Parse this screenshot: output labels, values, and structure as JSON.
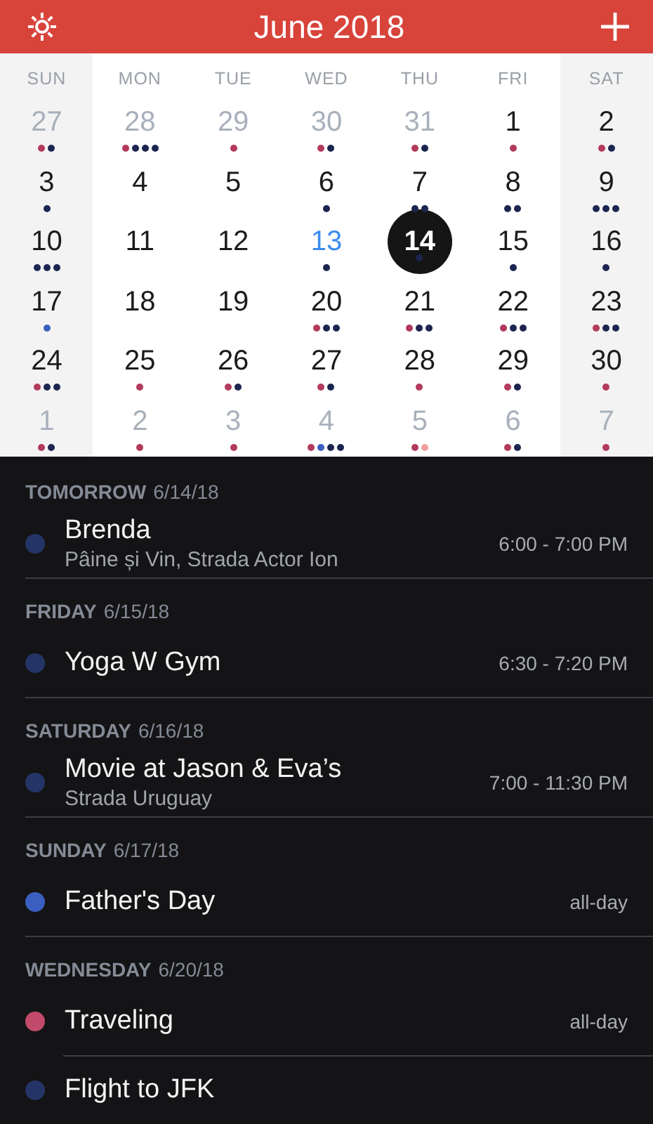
{
  "header": {
    "title": "June 2018"
  },
  "weekdays": [
    {
      "label": "SUN",
      "weekend": true
    },
    {
      "label": "MON",
      "weekend": false
    },
    {
      "label": "TUE",
      "weekend": false
    },
    {
      "label": "WED",
      "weekend": false
    },
    {
      "label": "THU",
      "weekend": false
    },
    {
      "label": "FRI",
      "weekend": false
    },
    {
      "label": "SAT",
      "weekend": true
    }
  ],
  "weeks": [
    {
      "days": [
        {
          "day": "27",
          "outside": true,
          "today": false,
          "selected": false,
          "dots": [
            {
              "color": "#b23a5a"
            },
            {
              "color": "#1c2550"
            }
          ]
        },
        {
          "day": "28",
          "outside": true,
          "today": false,
          "selected": false,
          "dots": [
            {
              "color": "#b23a5a"
            },
            {
              "color": "#1c2550"
            },
            {
              "color": "#1c2550"
            },
            {
              "color": "#1c2550"
            }
          ]
        },
        {
          "day": "29",
          "outside": true,
          "today": false,
          "selected": false,
          "dots": [
            {
              "color": "#b23a5a"
            }
          ]
        },
        {
          "day": "30",
          "outside": true,
          "today": false,
          "selected": false,
          "dots": [
            {
              "color": "#b23a5a"
            },
            {
              "color": "#1c2550"
            }
          ]
        },
        {
          "day": "31",
          "outside": true,
          "today": false,
          "selected": false,
          "dots": [
            {
              "color": "#b23a5a"
            },
            {
              "color": "#1c2550"
            }
          ]
        },
        {
          "day": "1",
          "outside": false,
          "today": false,
          "selected": false,
          "dots": [
            {
              "color": "#b23a5a"
            }
          ]
        },
        {
          "day": "2",
          "outside": false,
          "today": false,
          "selected": false,
          "dots": [
            {
              "color": "#b23a5a"
            },
            {
              "color": "#1c2550"
            }
          ]
        }
      ]
    },
    {
      "days": [
        {
          "day": "3",
          "outside": false,
          "today": false,
          "selected": false,
          "dots": [
            {
              "color": "#1c2550"
            }
          ]
        },
        {
          "day": "4",
          "outside": false,
          "today": false,
          "selected": false
        },
        {
          "day": "5",
          "outside": false,
          "today": false,
          "selected": false
        },
        {
          "day": "6",
          "outside": false,
          "today": false,
          "selected": false,
          "dots": [
            {
              "color": "#1c2550"
            }
          ]
        },
        {
          "day": "7",
          "outside": false,
          "today": false,
          "selected": false,
          "dots": [
            {
              "color": "#1c2550"
            },
            {
              "color": "#1c2550"
            }
          ]
        },
        {
          "day": "8",
          "outside": false,
          "today": false,
          "selected": false,
          "dots": [
            {
              "color": "#1c2550"
            },
            {
              "color": "#1c2550"
            }
          ]
        },
        {
          "day": "9",
          "outside": false,
          "today": false,
          "selected": false,
          "dots": [
            {
              "color": "#1c2550"
            },
            {
              "color": "#1c2550"
            },
            {
              "color": "#1c2550"
            }
          ]
        }
      ]
    },
    {
      "days": [
        {
          "day": "10",
          "outside": false,
          "today": false,
          "selected": false,
          "dots": [
            {
              "color": "#1c2550"
            },
            {
              "color": "#1c2550"
            },
            {
              "color": "#1c2550"
            }
          ]
        },
        {
          "day": "11",
          "outside": false,
          "today": false,
          "selected": false
        },
        {
          "day": "12",
          "outside": false,
          "today": false,
          "selected": false
        },
        {
          "day": "13",
          "outside": false,
          "today": true,
          "selected": false,
          "dots": [
            {
              "color": "#1c2550"
            }
          ]
        },
        {
          "day": "14",
          "outside": false,
          "today": false,
          "selected": true,
          "dots": [
            {
              "color": "#1c2550"
            }
          ]
        },
        {
          "day": "15",
          "outside": false,
          "today": false,
          "selected": false,
          "dots": [
            {
              "color": "#1c2550"
            }
          ]
        },
        {
          "day": "16",
          "outside": false,
          "today": false,
          "selected": false,
          "dots": [
            {
              "color": "#1c2550"
            }
          ]
        }
      ]
    },
    {
      "days": [
        {
          "day": "17",
          "outside": false,
          "today": false,
          "selected": false,
          "dots": [
            {
              "color": "#3a5fc0"
            }
          ]
        },
        {
          "day": "18",
          "outside": false,
          "today": false,
          "selected": false
        },
        {
          "day": "19",
          "outside": false,
          "today": false,
          "selected": false
        },
        {
          "day": "20",
          "outside": false,
          "today": false,
          "selected": false,
          "dots": [
            {
              "color": "#b23a5a"
            },
            {
              "color": "#1c2550"
            },
            {
              "color": "#1c2550"
            }
          ]
        },
        {
          "day": "21",
          "outside": false,
          "today": false,
          "selected": false,
          "dots": [
            {
              "color": "#b23a5a"
            },
            {
              "color": "#1c2550"
            },
            {
              "color": "#1c2550"
            }
          ]
        },
        {
          "day": "22",
          "outside": false,
          "today": false,
          "selected": false,
          "dots": [
            {
              "color": "#b23a5a"
            },
            {
              "color": "#1c2550"
            },
            {
              "color": "#1c2550"
            }
          ]
        },
        {
          "day": "23",
          "outside": false,
          "today": false,
          "selected": false,
          "dots": [
            {
              "color": "#b23a5a"
            },
            {
              "color": "#1c2550"
            },
            {
              "color": "#1c2550"
            }
          ]
        }
      ]
    },
    {
      "days": [
        {
          "day": "24",
          "outside": false,
          "today": false,
          "selected": false,
          "dots": [
            {
              "color": "#b23a5a"
            },
            {
              "color": "#1c2550"
            },
            {
              "color": "#1c2550"
            }
          ]
        },
        {
          "day": "25",
          "outside": false,
          "today": false,
          "selected": false,
          "dots": [
            {
              "color": "#b23a5a"
            }
          ]
        },
        {
          "day": "26",
          "outside": false,
          "today": false,
          "selected": false,
          "dots": [
            {
              "color": "#b23a5a"
            },
            {
              "color": "#1c2550"
            }
          ]
        },
        {
          "day": "27",
          "outside": false,
          "today": false,
          "selected": false,
          "dots": [
            {
              "color": "#b23a5a"
            },
            {
              "color": "#1c2550"
            }
          ]
        },
        {
          "day": "28",
          "outside": false,
          "today": false,
          "selected": false,
          "dots": [
            {
              "color": "#b23a5a"
            }
          ]
        },
        {
          "day": "29",
          "outside": false,
          "today": false,
          "selected": false,
          "dots": [
            {
              "color": "#b23a5a"
            },
            {
              "color": "#1c2550"
            }
          ]
        },
        {
          "day": "30",
          "outside": false,
          "today": false,
          "selected": false,
          "dots": [
            {
              "color": "#b23a5a"
            }
          ]
        }
      ]
    },
    {
      "days": [
        {
          "day": "1",
          "outside": true,
          "today": false,
          "selected": false,
          "dots": [
            {
              "color": "#b23a5a"
            },
            {
              "color": "#1c2550"
            }
          ]
        },
        {
          "day": "2",
          "outside": true,
          "today": false,
          "selected": false,
          "dots": [
            {
              "color": "#b23a5a"
            }
          ]
        },
        {
          "day": "3",
          "outside": true,
          "today": false,
          "selected": false,
          "dots": [
            {
              "color": "#b23a5a"
            }
          ]
        },
        {
          "day": "4",
          "outside": true,
          "today": false,
          "selected": false,
          "dots": [
            {
              "color": "#b23a5a"
            },
            {
              "color": "#3a5fc0"
            },
            {
              "color": "#1c2550"
            },
            {
              "color": "#1c2550"
            }
          ]
        },
        {
          "day": "5",
          "outside": true,
          "today": false,
          "selected": false,
          "dots": [
            {
              "color": "#b23a5a"
            },
            {
              "color": "#f0a0a0"
            }
          ]
        },
        {
          "day": "6",
          "outside": true,
          "today": false,
          "selected": false,
          "dots": [
            {
              "color": "#b23a5a"
            },
            {
              "color": "#1c2550"
            }
          ]
        },
        {
          "day": "7",
          "outside": true,
          "today": false,
          "selected": false,
          "dots": [
            {
              "color": "#b23a5a"
            }
          ]
        }
      ]
    }
  ],
  "agenda": [
    {
      "day": "TOMORROW",
      "date": "6/14/18",
      "events": [
        {
          "title": "Brenda",
          "location": "Pâine și Vin, Strada Actor Ion",
          "time": "6:00 - 7:00 PM",
          "color": "#243466"
        }
      ]
    },
    {
      "day": "FRIDAY",
      "date": "6/15/18",
      "events": [
        {
          "title": "Yoga W Gym",
          "time": "6:30 - 7:20 PM",
          "color": "#243466"
        }
      ]
    },
    {
      "day": "SATURDAY",
      "date": "6/16/18",
      "events": [
        {
          "title": "Movie at Jason & Eva’s",
          "location": "Strada Uruguay",
          "time": "7:00 - 11:30 PM",
          "color": "#243466"
        }
      ]
    },
    {
      "day": "SUNDAY",
      "date": "6/17/18",
      "events": [
        {
          "title": "Father's Day",
          "time": "all-day",
          "color": "#3a5fc0"
        }
      ]
    },
    {
      "day": "WEDNESDAY",
      "date": "6/20/18",
      "events": [
        {
          "title": "Traveling",
          "time": "all-day",
          "color": "#c24a6a"
        },
        {
          "title": "Flight to JFK",
          "color": "#243466"
        }
      ]
    }
  ]
}
